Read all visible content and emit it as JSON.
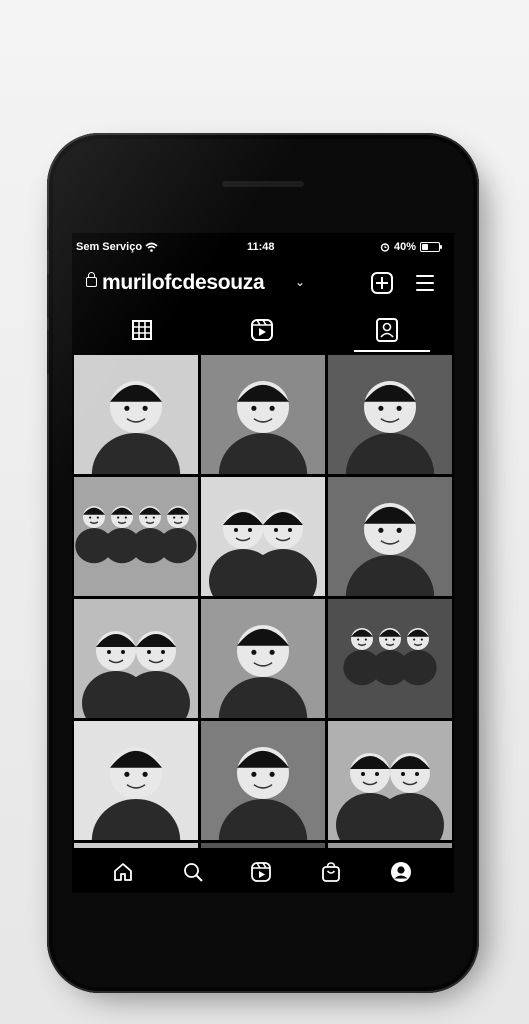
{
  "status_bar": {
    "carrier": "Sem Serviço",
    "time": "11:48",
    "battery": "40%",
    "battery_level": 0.4
  },
  "profile": {
    "username": "murilofcdesouza"
  },
  "icons": {
    "header": [
      "lock-icon",
      "chevron-down-icon",
      "add-icon",
      "menu-icon"
    ],
    "tabs": [
      "grid-icon",
      "reels-icon",
      "tagged-icon"
    ],
    "nav": [
      "home-icon",
      "search-icon",
      "reels-icon",
      "shop-icon",
      "profile-icon"
    ]
  },
  "photos": [
    "man in cap",
    "woman smiling",
    "woman in cap",
    "group of four men",
    "couple kissing",
    "woman smiling",
    "couple smiling",
    "man gesturing",
    "group selfie",
    "man standing",
    "man in cap sitting",
    "couple selfie"
  ]
}
